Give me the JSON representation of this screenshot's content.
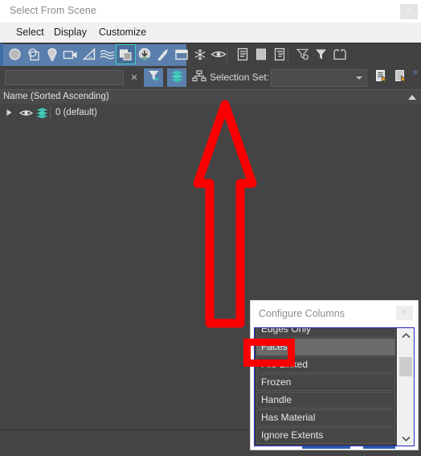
{
  "window": {
    "title": "Select From Scene",
    "close_label": "×"
  },
  "menubar": {
    "items": [
      {
        "label": "Select",
        "name": "menu-select"
      },
      {
        "label": "Display",
        "name": "menu-display"
      },
      {
        "label": "Customize",
        "name": "menu-customize"
      }
    ]
  },
  "toolbar_filters": {
    "buttons": [
      {
        "icon": "geometry-sphere-icon",
        "selected": false
      },
      {
        "icon": "shapes-icon",
        "selected": false
      },
      {
        "icon": "lights-bulb-icon",
        "selected": false
      },
      {
        "icon": "cameras-icon",
        "selected": false
      },
      {
        "icon": "helpers-ruler-icon",
        "selected": false
      },
      {
        "icon": "space-warps-waves-icon",
        "selected": false
      },
      {
        "icon": "groups-xrefs-icon",
        "selected": true
      },
      {
        "icon": "xrefs-download-icon",
        "selected": false
      },
      {
        "icon": "bones-icon",
        "selected": false
      },
      {
        "icon": "containers-icon",
        "selected": false
      }
    ],
    "extra_buttons": [
      {
        "icon": "freeze-snowflake-icon"
      },
      {
        "icon": "hidden-eye-icon"
      },
      {
        "icon": "display-list-icon"
      },
      {
        "icon": "display-blank-icon"
      },
      {
        "icon": "display-children-icon"
      },
      {
        "icon": "filter-funnel-gear-icon"
      },
      {
        "icon": "filter-funnel-icon"
      },
      {
        "icon": "container-box-icon"
      }
    ]
  },
  "search_row": {
    "find_value": "",
    "find_placeholder": "",
    "clear_label": "×",
    "toggle_icons": [
      {
        "icon": "select-filter-funnel-icon",
        "active": true
      },
      {
        "icon": "layers-stack-icon",
        "active": true
      },
      {
        "icon": "hierarchy-tree-icon",
        "active": false
      }
    ],
    "selection_set_label": "Selection Set:",
    "selection_set_value": "",
    "buttons": [
      {
        "icon": "edit-named-selection-icon"
      },
      {
        "icon": "new-selection-set-icon"
      }
    ],
    "overflow_label": "»"
  },
  "column_header": {
    "label": "Name (Sorted Ascending)",
    "sort_icon": "sort-ascending-triangle-icon"
  },
  "tree": {
    "rows": [
      {
        "expander_icon": "expand-triangle-icon",
        "visibility_icon": "eye-icon",
        "type_icon": "layer-stack-icon",
        "label": "0 (default)"
      }
    ]
  },
  "configure_columns": {
    "title": "Configure Columns",
    "close_label": "×",
    "items": [
      {
        "label": "Edges Only",
        "highlighted": false,
        "clipped": true
      },
      {
        "label": "Faces",
        "highlighted": true,
        "clipped": false
      },
      {
        "label": "File Linked",
        "highlighted": false,
        "clipped": false
      },
      {
        "label": "Frozen",
        "highlighted": false,
        "clipped": false
      },
      {
        "label": "Handle",
        "highlighted": false,
        "clipped": false
      },
      {
        "label": "Has Material",
        "highlighted": false,
        "clipped": false
      },
      {
        "label": "Ignore Extents",
        "highlighted": false,
        "clipped": false
      }
    ],
    "scrollbar": {
      "up_icon": "chevron-up-icon",
      "down_icon": "chevron-down-icon"
    }
  },
  "annotations": {
    "arrow": {
      "name": "red-up-arrow-annotation",
      "color": "#fb0000",
      "direction": "up"
    },
    "box": {
      "name": "red-highlight-box-annotation",
      "color": "#fb0000",
      "targets": "Faces"
    }
  },
  "colors": {
    "window_bg": "#404040",
    "titlebar_bg": "#ffffff",
    "menubar_bg": "#f0f0f0",
    "toolbar_bg": "#424242",
    "toolbar_blue_group": "#5a7fad",
    "accent_teal": "#3ecfc0",
    "list_bg": "#444444",
    "popup_bg": "#ffffff",
    "popup_border_blue": "#2b2bbf",
    "annotation_red": "#fb0000"
  }
}
